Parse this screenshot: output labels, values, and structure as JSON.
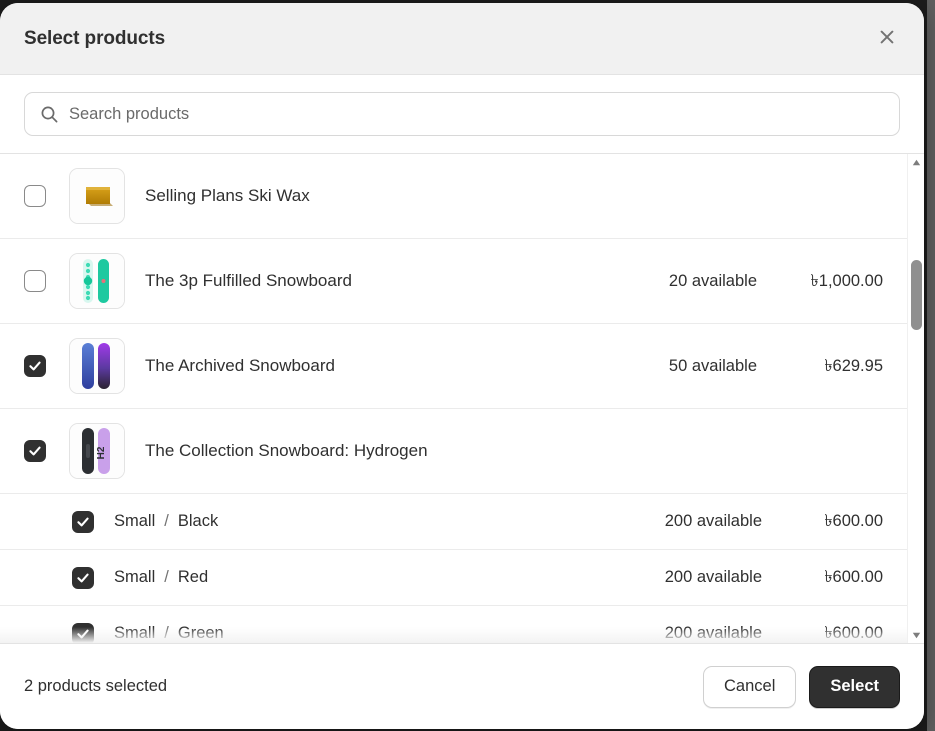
{
  "modal": {
    "title": "Select products",
    "close_icon": "close-icon"
  },
  "search": {
    "icon": "search-icon",
    "placeholder": "Search products",
    "value": ""
  },
  "list": {
    "rows": [
      {
        "kind": "product",
        "title": "Selling Plans Ski Wax",
        "checked": false,
        "availability": "",
        "price": "",
        "thumb": "ski-wax-thumbnail"
      },
      {
        "kind": "product",
        "title": "The 3p Fulfilled Snowboard",
        "checked": false,
        "availability": "20 available",
        "price": "৳1,000.00",
        "thumb": "teal-snowboard-thumbnail"
      },
      {
        "kind": "product",
        "title": "The Archived Snowboard",
        "checked": true,
        "availability": "50 available",
        "price": "৳629.95",
        "thumb": "blue-purple-snowboard-thumbnail"
      },
      {
        "kind": "product",
        "title": "The Collection Snowboard: Hydrogen",
        "checked": true,
        "availability": "",
        "price": "",
        "thumb": "hydrogen-snowboard-thumbnail"
      },
      {
        "kind": "variant",
        "option_size": "Small",
        "separator": "/",
        "option_color": "Black",
        "checked": true,
        "availability": "200 available",
        "price": "৳600.00"
      },
      {
        "kind": "variant",
        "option_size": "Small",
        "separator": "/",
        "option_color": "Red",
        "checked": true,
        "availability": "200 available",
        "price": "৳600.00"
      },
      {
        "kind": "variant",
        "option_size": "Small",
        "separator": "/",
        "option_color": "Green",
        "checked": true,
        "availability": "200 available",
        "price": "৳600.00"
      }
    ]
  },
  "scrollbar": {
    "up_icon": "scroll-up-arrow-icon",
    "down_icon": "scroll-down-arrow-icon"
  },
  "footer": {
    "status": "2 products selected",
    "cancel_label": "Cancel",
    "select_label": "Select"
  },
  "colors": {
    "accent_dark": "#303030",
    "header_bg": "#f1f1f1",
    "border": "#e3e3e3",
    "text": "#303030",
    "muted": "#6a6a6a"
  }
}
